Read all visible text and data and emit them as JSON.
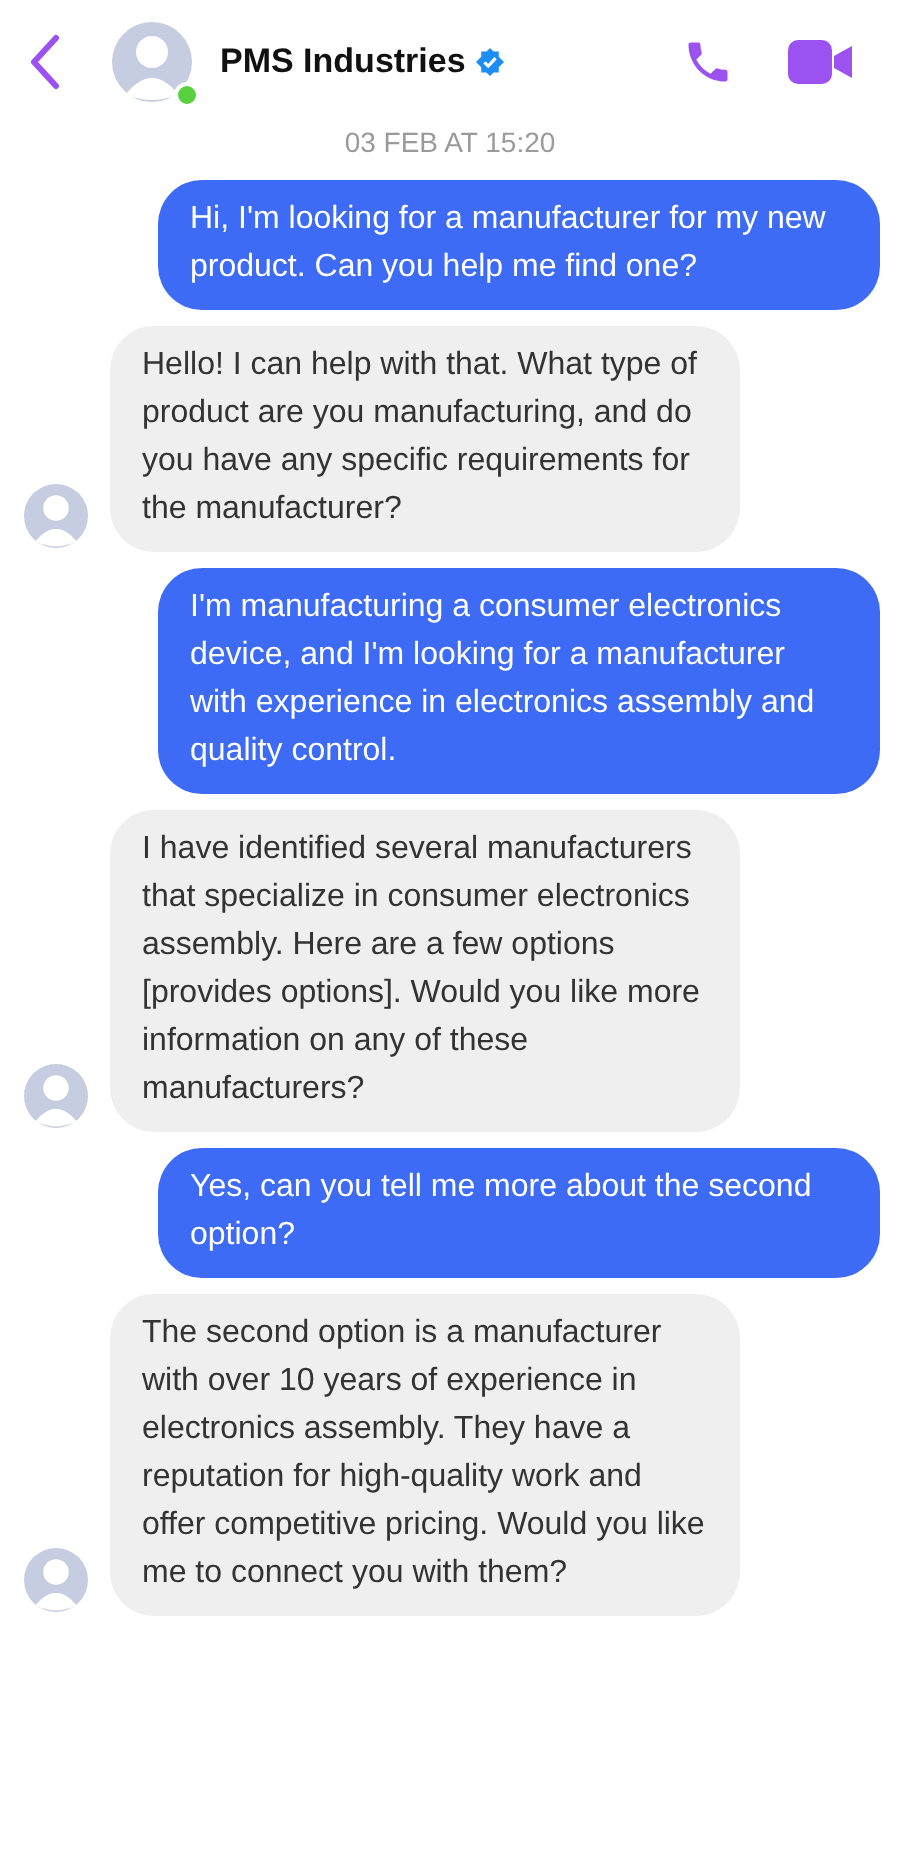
{
  "header": {
    "name": "PMS Industries",
    "verified": true,
    "online": true
  },
  "timestamp": "03 FEB AT 15:20",
  "messages": [
    {
      "kind": "sent",
      "text": "Hi, I'm looking for a manufacturer for my new product. Can you help me find one?"
    },
    {
      "kind": "received",
      "text": "Hello! I can help with that. What type of product are you manufacturing, and do you have any specific requirements for the manufacturer?"
    },
    {
      "kind": "sent",
      "text": "I'm manufacturing a consumer electronics device, and I'm looking for a manufacturer with experience in electronics assembly and quality control."
    },
    {
      "kind": "received",
      "text": "I have identified several manufacturers that specialize in consumer electronics assembly. Here are a few options [provides options]. Would you like more information on any of these manufacturers?"
    },
    {
      "kind": "sent",
      "text": "Yes, can you tell me more about the second option?"
    },
    {
      "kind": "received",
      "text": "The second option is a manufacturer with over 10 years of experience in electronics assembly. They have a reputation for high-quality work and offer competitive pricing. Would you like me to connect you with them?"
    }
  ]
}
